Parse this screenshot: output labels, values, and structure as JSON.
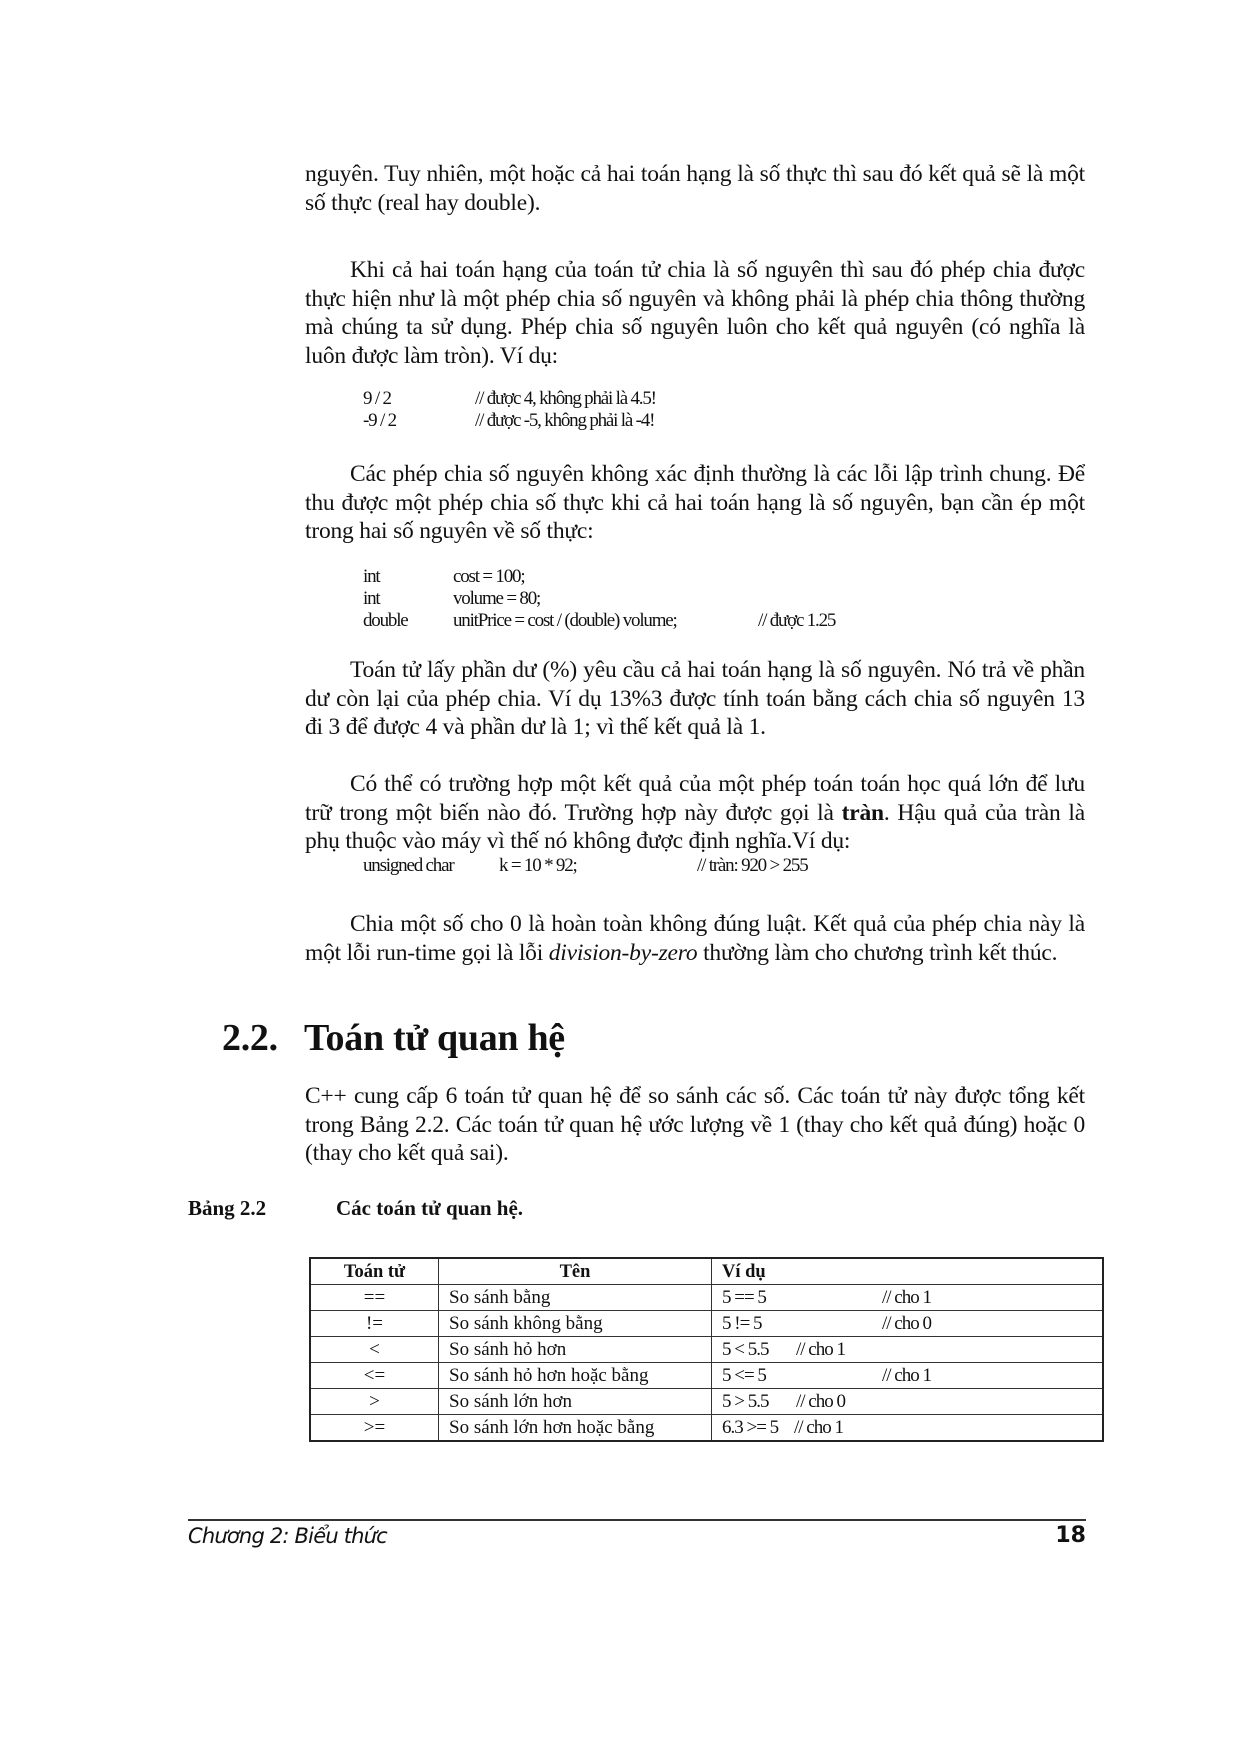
{
  "paragraphs": {
    "p1": "nguyên. Tuy nhiên, một hoặc cả hai toán hạng là số thực thì sau đó kết quả sẽ là một số thực (real hay double).",
    "p2": "Khi cả hai toán hạng của toán tử chia là số nguyên thì sau đó phép chia được thực hiện như là một phép chia số nguyên và không phải là phép chia thông thường mà chúng ta sử dụng. Phép chia số nguyên luôn cho kết quả nguyên (có nghĩa là luôn được làm tròn). Ví dụ:",
    "p3": "Các phép chia số nguyên không xác định thường là các lỗi lập trình chung. Để thu được một phép chia số thực khi cả hai toán hạng là số nguyên, bạn cần ép một trong hai số nguyên về số thực:",
    "p4": "Toán tử lấy phần dư (%) yêu cầu cả hai toán hạng là số nguyên. Nó trả về phần dư còn lại của phép chia. Ví dụ 13%3 được tính toán bằng cách chia số nguyên 13 đi 3 để được 4 và phần dư là 1; vì thế kết quả là 1.",
    "p5_before": "Có thể có trường hợp một kết quả của một phép toán toán học quá lớn để lưu trữ trong một biến nào đó. Trường hợp này được gọi là ",
    "p5_bold": "tràn",
    "p5_after": ". Hậu quả của tràn là phụ thuộc vào máy vì thế nó không được định nghĩa.Ví dụ:",
    "p6_before": "Chia một số cho 0 là hoàn toàn không đúng luật. Kết quả của phép chia này là một lỗi run-time gọi là lỗi ",
    "p6_italic": "division-by-zero",
    "p6_after": " thường làm cho chương trình kết thúc.",
    "p7": "C++ cung cấp 6 toán tử quan hệ để so sánh các số. Các toán tử này được tổng kết trong Bảng 2.2. Các toán tử quan hệ ước lượng về 1 (thay cho kết quả đúng) hoặc 0 (thay cho kết quả sai)."
  },
  "code_division": [
    {
      "expr": "9 / 2",
      "comment": "// được 4, không phải là 4.5!"
    },
    {
      "expr": "-9 / 2",
      "comment": "// được -5, không phải là -4!"
    }
  ],
  "code_cast": [
    {
      "type": "int",
      "stmt": "cost = 100;",
      "comment": ""
    },
    {
      "type": "int",
      "stmt": "volume = 80;",
      "comment": ""
    },
    {
      "type": "double",
      "stmt": "unitPrice = cost / (double) volume;",
      "comment": "// được 1.25"
    }
  ],
  "code_overflow": {
    "type": "unsigned char",
    "stmt": "k = 10 * 92;",
    "comment": "// tràn: 920 > 255"
  },
  "section": {
    "number": "2.2.",
    "title": "Toán tử quan hệ"
  },
  "table_caption": {
    "label": "Bảng 2.2",
    "title": "Các toán tử quan hệ."
  },
  "table": {
    "headers": [
      "Toán tử",
      "Tên",
      "Ví dụ"
    ],
    "rows": [
      {
        "op": "==",
        "name": "So sánh bằng",
        "expr": "5 == 5",
        "comment": "// cho 1"
      },
      {
        "op": "!=",
        "name": "So sánh không bằng",
        "expr": "5 != 5",
        "comment": "// cho 0"
      },
      {
        "op": "<",
        "name": "So sánh hỏ hơn",
        "expr": "5 < 5.5",
        "comment": "// cho 1"
      },
      {
        "op": "<=",
        "name": "So sánh hỏ hơn hoặc bằng",
        "expr": "5 <= 5",
        "comment": "// cho 1"
      },
      {
        "op": ">",
        "name": "So sánh lớn hơn",
        "expr": "5 > 5.5",
        "comment": "// cho 0"
      },
      {
        "op": ">=",
        "name": "So sánh lớn hơn hoặc bằng",
        "expr": "6.3 >= 5",
        "comment": "// cho 1"
      }
    ]
  },
  "footer": {
    "chapter": "Chương 2: Biểu thức",
    "page_number": "18"
  }
}
